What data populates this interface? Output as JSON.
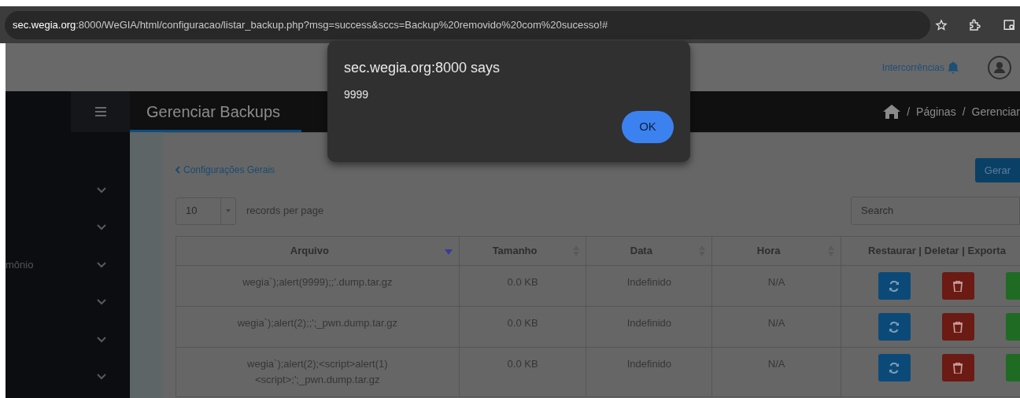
{
  "browser": {
    "url_host": "sec.wegia.org",
    "url_rest": ":8000/WeGIA/html/configuracao/listar_backup.php?msg=success&sccs=Backup%20removido%20com%20sucesso!#"
  },
  "header": {
    "link": "Intercorrências"
  },
  "sidebar": {
    "items": [
      {
        "kind": "submenu"
      },
      {
        "kind": "submenu"
      },
      {
        "kind": "submenu",
        "label": "mônio"
      },
      {
        "kind": "submenu"
      },
      {
        "kind": "submenu"
      },
      {
        "kind": "submenu"
      }
    ]
  },
  "page_title": "Gerenciar Backups",
  "breadcrumb": [
    {
      "separator": "/",
      "label": "Páginas"
    },
    {
      "separator": "/",
      "label": "Gerenciar"
    }
  ],
  "back_link": "Configurações Gerais",
  "generate_button": "Gerar",
  "page_length": {
    "value": "10",
    "label": "records per page"
  },
  "search": {
    "placeholder": "Search"
  },
  "table": {
    "columns": [
      {
        "label": "Arquivo",
        "sortable": true,
        "sorted": true
      },
      {
        "label": "Tamanho",
        "sortable": true,
        "sorted": false
      },
      {
        "label": "Data",
        "sortable": true,
        "sorted": false
      },
      {
        "label": "Hora",
        "sortable": true,
        "sorted": false
      },
      {
        "label": "Restaurar | Deletar | Exporta",
        "sortable": false,
        "sorted": false
      }
    ],
    "rows": [
      {
        "cells": [
          "wegia`);alert(9999);;'.dump.tar.gz",
          "0.0 KB",
          "Indefinido",
          "N/A"
        ]
      },
      {
        "cells": [
          "wegia`);alert(2);;';_pwn.dump.tar.gz",
          "0.0 KB",
          "Indefinido",
          "N/A"
        ]
      },
      {
        "cells": [
          "wegia`);alert(2);<script>alert(1)\n<script>;';_pwn.dump.tar.gz",
          "0.0 KB",
          "Indefinido",
          "N/A"
        ]
      }
    ]
  },
  "dialog": {
    "title": "sec.wegia.org:8000 says",
    "message": "9999",
    "button": "OK"
  }
}
